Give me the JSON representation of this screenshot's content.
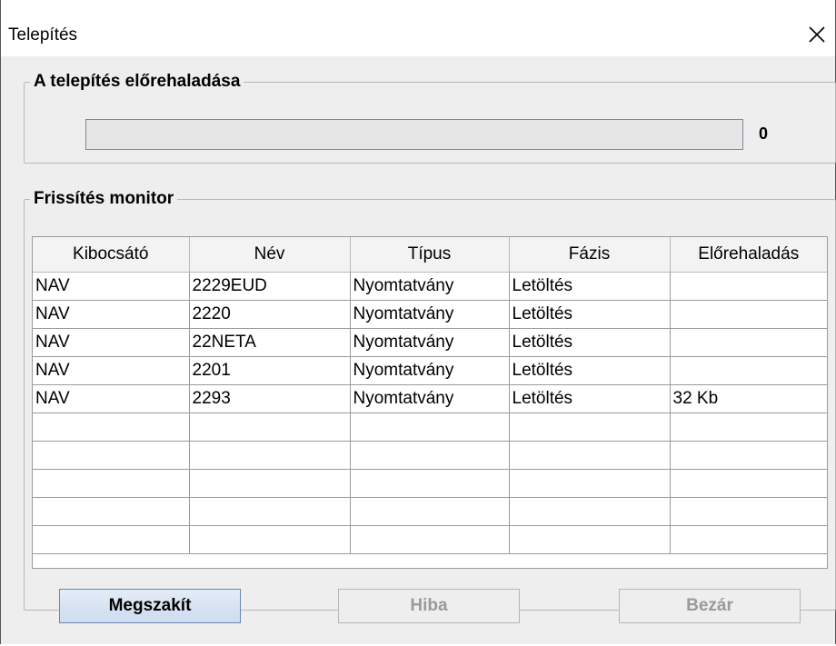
{
  "window": {
    "title": "Telepítés"
  },
  "progress_group": {
    "legend": "A telepítés előrehaladása",
    "progress_fraction": 0,
    "value_label": "0"
  },
  "monitor_group": {
    "legend": "Frissítés monitor",
    "columns": [
      "Kibocsátó",
      "Név",
      "Típus",
      "Fázis",
      "Előrehaladás"
    ],
    "rows": [
      [
        "NAV",
        "2229EUD",
        "Nyomtatvány",
        "Letöltés",
        ""
      ],
      [
        "NAV",
        "2220",
        "Nyomtatvány",
        "Letöltés",
        ""
      ],
      [
        "NAV",
        "22NETA",
        "Nyomtatvány",
        "Letöltés",
        ""
      ],
      [
        "NAV",
        "2201",
        "Nyomtatvány",
        "Letöltés",
        ""
      ],
      [
        "NAV",
        "2293",
        "Nyomtatvány",
        "Letöltés",
        "32 Kb"
      ],
      [
        "",
        "",
        "",
        "",
        ""
      ],
      [
        "",
        "",
        "",
        "",
        ""
      ],
      [
        "",
        "",
        "",
        "",
        ""
      ],
      [
        "",
        "",
        "",
        "",
        ""
      ],
      [
        "",
        "",
        "",
        "",
        ""
      ]
    ]
  },
  "buttons": {
    "cancel_label": "Megszakít",
    "error_label": "Hiba",
    "close_label": "Bezár"
  },
  "icons": {
    "close": "close-icon"
  },
  "colors": {
    "primary_button_border": "#6b87b5",
    "disabled_text": "#9a9a9a"
  }
}
